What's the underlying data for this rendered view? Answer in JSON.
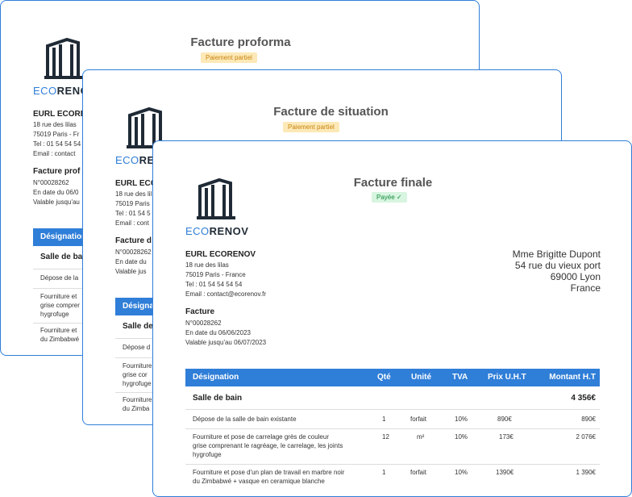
{
  "brand": {
    "eco": "ECO",
    "renov": "RENOV"
  },
  "company": {
    "name": "EURL ECORENOV",
    "street": "18 rue des lilas",
    "city": "75019 Paris - France",
    "tel": "Tel : 01 54 54 54 54",
    "email": "Email : contact@ecorenov.fr"
  },
  "company_truncated": {
    "city_back": "75019 Paris - Fr",
    "tel_back": "Tel : 01 54 54 54",
    "email_back": "Email : contact",
    "name_mid": "EURL ECO",
    "street_mid": "18 rue des lil",
    "city_mid": "75019 Paris",
    "tel_mid": "Tel : 01 54 5",
    "email_mid": "Email : cont"
  },
  "cards": {
    "proforma": {
      "title": "Facture proforma",
      "status": "Paiement partiel",
      "doc_label": "Facture prof",
      "number": "N°00028262",
      "date": "En date du 06/0",
      "valid": "Valable jusqu'au",
      "th_designation": "Désignation",
      "section": "Salle de ba",
      "rows": [
        "Dépose de la",
        "Fourniture et",
        "grise comprer",
        "hygrofuge",
        "Fourniture et",
        "du Zimbabwé"
      ]
    },
    "situation": {
      "title": "Facture de situation",
      "status": "Paiement partiel",
      "doc_label": "Facture d",
      "number": "N°00028262",
      "date": "En date du",
      "valid": "Valable jus",
      "th_designation": "Désigna",
      "section": "Salle de",
      "rows": [
        "Dépose d",
        "Fourniture",
        "grise cor",
        "hygrofuge",
        "Fourniture",
        "du Zimba"
      ]
    },
    "finale": {
      "title": "Facture finale",
      "status": "Payée",
      "doc_label": "Facture",
      "number": "N°00028262",
      "date": "En date du 06/06/2023",
      "valid": "Valable jusqu'au 06/07/2023",
      "recipient": [
        "Mme Brigitte Dupont",
        "54 rue du vieux port",
        "69000 Lyon",
        "France"
      ],
      "headers": [
        "Désignation",
        "Qté",
        "Unité",
        "TVA",
        "Prix U.H.T",
        "Montant H.T"
      ],
      "section": {
        "name": "Salle de bain",
        "total": "4 356€"
      },
      "rows": [
        {
          "desc": [
            "Dépose de la salle de bain existante"
          ],
          "qty": "1",
          "unit": "forfait",
          "tva": "10%",
          "pu": "890€",
          "total": "890€"
        },
        {
          "desc": [
            "Fourniture et pose de carrelage grès  de couleur",
            "grise comprenant le ragréage, le carrelage, les joints",
            "hygrofuge"
          ],
          "qty": "12",
          "unit": "m²",
          "tva": "10%",
          "pu": "173€",
          "total": "2 076€"
        },
        {
          "desc": [
            "Fourniture et pose d'un plan de travail en marbre noir",
            "du Zimbabwé + vasque en ceramique blanche"
          ],
          "qty": "1",
          "unit": "forfait",
          "tva": "10%",
          "pu": "1390€",
          "total": "1 390€"
        }
      ]
    }
  },
  "colors": {
    "accent": "#2f7ed8",
    "partial_bg": "#fde9b7",
    "partial_fg": "#c8830f",
    "paid_bg": "#d7f5e0",
    "paid_fg": "#138a3c"
  }
}
